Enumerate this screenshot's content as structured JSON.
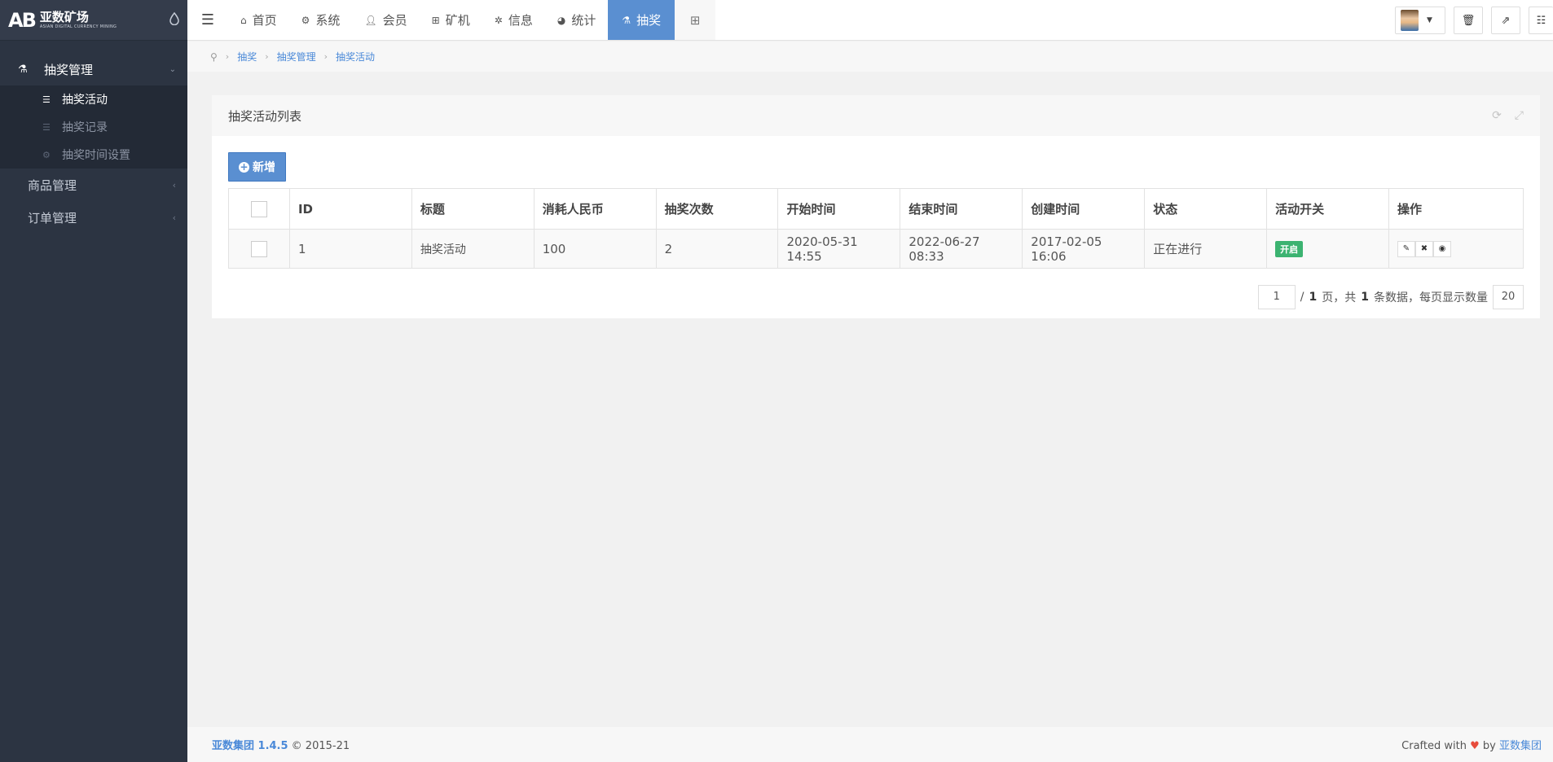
{
  "brand": {
    "name": "亚数矿场",
    "sub": "ASIAN DIGITAL CURRENCY MINING",
    "mark": "AB"
  },
  "sidebar": {
    "group": {
      "label": "抽奖管理",
      "items": [
        "抽奖活动",
        "抽奖记录",
        "抽奖时间设置"
      ]
    },
    "others": [
      "商品管理",
      "订单管理"
    ]
  },
  "topnav": {
    "tabs": [
      "首页",
      "系统",
      "会员",
      "矿机",
      "信息",
      "统计",
      "抽奖"
    ],
    "active_index": 6
  },
  "breadcrumb": [
    "抽奖",
    "抽奖管理",
    "抽奖活动"
  ],
  "card": {
    "title": "抽奖活动列表",
    "add_label": "新增",
    "columns": [
      "ID",
      "标题",
      "消耗人民币",
      "抽奖次数",
      "开始时间",
      "结束时间",
      "创建时间",
      "状态",
      "活动开关",
      "操作"
    ],
    "rows": [
      {
        "id": "1",
        "title": "抽奖活动",
        "cost": "100",
        "times": "2",
        "start": "2020-05-31 14:55",
        "end": "2022-06-27 08:33",
        "created": "2017-02-05 16:06",
        "status": "正在进行",
        "switch": "开启"
      }
    ]
  },
  "pager": {
    "page": "1",
    "total_pages": "1",
    "total_rows": "1",
    "per_page": "20",
    "t1": "/ ",
    "t2": " 页，共 ",
    "t3": " 条数据，每页显示数量"
  },
  "footer": {
    "company": "亚数集团 1.4.5",
    "copy": " © 2015-21",
    "crafted": "Crafted with ",
    "by": " by ",
    "by_link": "亚数集团"
  }
}
